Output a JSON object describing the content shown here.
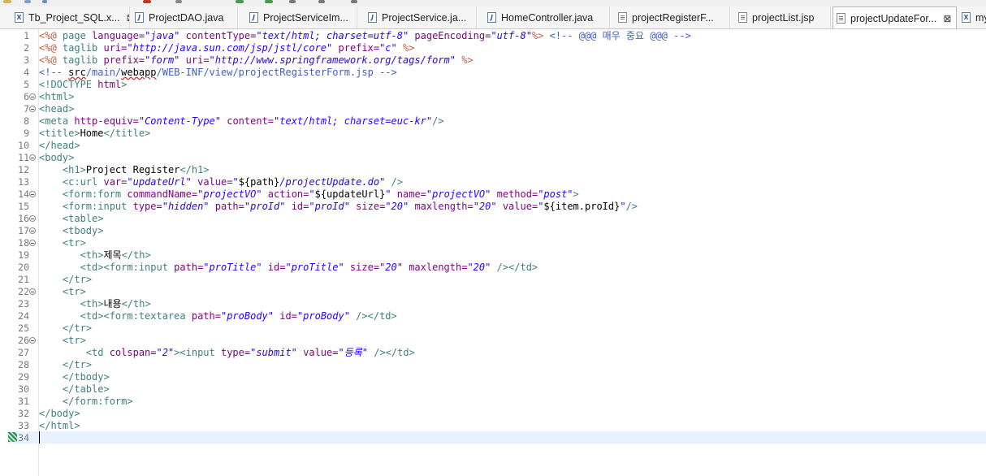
{
  "tabs": [
    {
      "label": "Tb_Project_SQL.x...",
      "icon": "xml-file-icon",
      "close": "⊠",
      "active": false
    },
    {
      "label": "ProjectDAO.java",
      "icon": "java-file-icon",
      "active": false
    },
    {
      "label": "ProjectServiceIm...",
      "icon": "java-file-icon",
      "active": false
    },
    {
      "label": "ProjectService.ja...",
      "icon": "java-file-icon",
      "active": false
    },
    {
      "label": "HomeController.java",
      "icon": "java-file-icon",
      "active": false
    },
    {
      "label": "projectRegisterF...",
      "icon": "jsp-file-icon",
      "active": false
    },
    {
      "label": "projectList.jsp",
      "icon": "jsp-file-icon",
      "active": false
    },
    {
      "label": "projectUpdateFor...",
      "icon": "jsp-file-icon",
      "close": "⊠",
      "active": true
    },
    {
      "label": "my",
      "icon": "xml-file-icon",
      "active": false
    }
  ],
  "icon_glyphs": {
    "xml": "X",
    "java": "J"
  },
  "line_numbers": [
    "1",
    "2",
    "3",
    "4",
    "5",
    "6",
    "7",
    "8",
    "9",
    "10",
    "11",
    "12",
    "13",
    "14",
    "15",
    "16",
    "17",
    "18",
    "19",
    "20",
    "21",
    "22",
    "23",
    "24",
    "25",
    "26",
    "27",
    "28",
    "29",
    "30",
    "31",
    "32",
    "33",
    "34"
  ],
  "code_lines": [
    {
      "num": "1",
      "fold": false,
      "segments": [
        [
          "jsp",
          "<%@ "
        ],
        [
          "k",
          "page "
        ],
        [
          "a",
          "language="
        ],
        [
          "s",
          "\"java\""
        ],
        [
          "a",
          " contentType="
        ],
        [
          "s",
          "\"text/html; charset=utf-8\""
        ],
        [
          "a",
          " pageEncoding="
        ],
        [
          "s",
          "\"utf-8\""
        ],
        [
          "jsp",
          "%>"
        ],
        [
          "cm",
          " <!-- @@@ 매우 중요 @@@ -->"
        ]
      ]
    },
    {
      "num": "2",
      "fold": false,
      "segments": [
        [
          "jsp",
          "<%@ "
        ],
        [
          "k",
          "taglib "
        ],
        [
          "a",
          "uri="
        ],
        [
          "s",
          "\"http://java.sun.com/jsp/jstl/core\""
        ],
        [
          "a",
          " prefix="
        ],
        [
          "s",
          "\"c\""
        ],
        [
          "jsp",
          " %>"
        ]
      ]
    },
    {
      "num": "3",
      "fold": false,
      "segments": [
        [
          "jsp",
          "<%@ "
        ],
        [
          "k",
          "taglib "
        ],
        [
          "a",
          "prefix="
        ],
        [
          "s",
          "\"form\""
        ],
        [
          "a",
          " uri="
        ],
        [
          "s",
          "\"http://www.springframework.org/tags/form\""
        ],
        [
          "jsp",
          " %>"
        ]
      ]
    },
    {
      "num": "4",
      "fold": false,
      "segments": [
        [
          "cm",
          "<!-- "
        ],
        [
          "ws",
          "src"
        ],
        [
          "cm",
          "/main/"
        ],
        [
          "ws",
          "webapp"
        ],
        [
          "cm",
          "/WEB-INF/view/projectRegisterForm.jsp -->"
        ]
      ]
    },
    {
      "num": "5",
      "fold": false,
      "segments": [
        [
          "k",
          "<!DOCTYPE "
        ],
        [
          "a",
          "html"
        ],
        [
          "k",
          ">"
        ]
      ]
    },
    {
      "num": "6",
      "fold": true,
      "segments": [
        [
          "k",
          "<html>"
        ]
      ]
    },
    {
      "num": "7",
      "fold": true,
      "segments": [
        [
          "k",
          "<head>"
        ]
      ]
    },
    {
      "num": "8",
      "fold": false,
      "segments": [
        [
          "k",
          "<meta "
        ],
        [
          "a",
          "http-equiv="
        ],
        [
          "s",
          "\"Content-Type\""
        ],
        [
          "a",
          " content="
        ],
        [
          "s",
          "\"text/html; charset=euc-kr\""
        ],
        [
          "k",
          "/>"
        ]
      ]
    },
    {
      "num": "9",
      "fold": false,
      "segments": [
        [
          "k",
          "<title>"
        ],
        [
          "t",
          "Home"
        ],
        [
          "k",
          "</title>"
        ]
      ]
    },
    {
      "num": "10",
      "fold": false,
      "segments": [
        [
          "k",
          "</head>"
        ]
      ]
    },
    {
      "num": "11",
      "fold": true,
      "segments": [
        [
          "k",
          "<body>"
        ]
      ]
    },
    {
      "num": "12",
      "fold": false,
      "segments": [
        [
          "t",
          "    "
        ],
        [
          "k",
          "<h1>"
        ],
        [
          "t",
          "Project Register"
        ],
        [
          "k",
          "</h1>"
        ]
      ]
    },
    {
      "num": "13",
      "fold": false,
      "segments": [
        [
          "t",
          "    "
        ],
        [
          "k",
          "<c:url "
        ],
        [
          "a",
          "var="
        ],
        [
          "s",
          "\"updateUrl\""
        ],
        [
          "a",
          " value="
        ],
        [
          "s",
          "\""
        ],
        [
          "t",
          "${path}"
        ],
        [
          "s",
          "/projectUpdate.do\""
        ],
        [
          "k",
          " />"
        ]
      ]
    },
    {
      "num": "14",
      "fold": true,
      "segments": [
        [
          "t",
          "    "
        ],
        [
          "k",
          "<form:form "
        ],
        [
          "a",
          "commandName="
        ],
        [
          "s",
          "\"projectVO\""
        ],
        [
          "a",
          " action="
        ],
        [
          "s",
          "\""
        ],
        [
          "t",
          "${updateUrl}"
        ],
        [
          "s",
          "\""
        ],
        [
          "a",
          " name="
        ],
        [
          "s",
          "\"projectVO\""
        ],
        [
          "a",
          " method="
        ],
        [
          "s",
          "\"post\""
        ],
        [
          "k",
          ">"
        ]
      ]
    },
    {
      "num": "15",
      "fold": false,
      "segments": [
        [
          "t",
          "    "
        ],
        [
          "k",
          "<form:input "
        ],
        [
          "a",
          "type="
        ],
        [
          "s",
          "\"hidden\""
        ],
        [
          "a",
          " path="
        ],
        [
          "s",
          "\"proId\""
        ],
        [
          "a",
          " id="
        ],
        [
          "s",
          "\"proId\""
        ],
        [
          "a",
          " size="
        ],
        [
          "s",
          "\"20\""
        ],
        [
          "a",
          " maxlength="
        ],
        [
          "s",
          "\"20\""
        ],
        [
          "a",
          " value="
        ],
        [
          "s",
          "\""
        ],
        [
          "t",
          "${item.proId}"
        ],
        [
          "s",
          "\""
        ],
        [
          "k",
          "/>"
        ]
      ]
    },
    {
      "num": "16",
      "fold": true,
      "segments": [
        [
          "t",
          "    "
        ],
        [
          "k",
          "<table>"
        ]
      ]
    },
    {
      "num": "17",
      "fold": true,
      "segments": [
        [
          "t",
          "    "
        ],
        [
          "k",
          "<tbody>"
        ]
      ]
    },
    {
      "num": "18",
      "fold": true,
      "segments": [
        [
          "t",
          "    "
        ],
        [
          "k",
          "<tr>"
        ]
      ]
    },
    {
      "num": "19",
      "fold": false,
      "segments": [
        [
          "t",
          "       "
        ],
        [
          "k",
          "<th>"
        ],
        [
          "t",
          "제목"
        ],
        [
          "k",
          "</th>"
        ]
      ]
    },
    {
      "num": "20",
      "fold": false,
      "segments": [
        [
          "t",
          "       "
        ],
        [
          "k",
          "<td><form:input "
        ],
        [
          "a",
          "path="
        ],
        [
          "s",
          "\"proTitle\""
        ],
        [
          "a",
          " id="
        ],
        [
          "s",
          "\"proTitle\""
        ],
        [
          "a",
          " size="
        ],
        [
          "s",
          "\"20\""
        ],
        [
          "a",
          " maxlength="
        ],
        [
          "s",
          "\"20\""
        ],
        [
          "k",
          " /></td>"
        ]
      ]
    },
    {
      "num": "21",
      "fold": false,
      "segments": [
        [
          "t",
          "    "
        ],
        [
          "k",
          "</tr>"
        ]
      ]
    },
    {
      "num": "22",
      "fold": true,
      "segments": [
        [
          "t",
          "    "
        ],
        [
          "k",
          "<tr>"
        ]
      ]
    },
    {
      "num": "23",
      "fold": false,
      "segments": [
        [
          "t",
          "       "
        ],
        [
          "k",
          "<th>"
        ],
        [
          "t",
          "내용"
        ],
        [
          "k",
          "</th>"
        ]
      ]
    },
    {
      "num": "24",
      "fold": false,
      "segments": [
        [
          "t",
          "       "
        ],
        [
          "k",
          "<td><form:textarea "
        ],
        [
          "a",
          "path="
        ],
        [
          "s",
          "\"proBody\""
        ],
        [
          "a",
          " id="
        ],
        [
          "s",
          "\"proBody\""
        ],
        [
          "k",
          " /></td>"
        ]
      ]
    },
    {
      "num": "25",
      "fold": false,
      "segments": [
        [
          "t",
          "    "
        ],
        [
          "k",
          "</tr>"
        ]
      ]
    },
    {
      "num": "26",
      "fold": true,
      "segments": [
        [
          "t",
          "    "
        ],
        [
          "k",
          "<tr>"
        ]
      ]
    },
    {
      "num": "27",
      "fold": false,
      "segments": [
        [
          "t",
          "        "
        ],
        [
          "k",
          "<td "
        ],
        [
          "a",
          "colspan="
        ],
        [
          "s",
          "\"2\""
        ],
        [
          "k",
          "><input "
        ],
        [
          "a",
          "type="
        ],
        [
          "s",
          "\"submit\""
        ],
        [
          "a",
          " value="
        ],
        [
          "s",
          "\"등록\""
        ],
        [
          "k",
          " /></td>"
        ]
      ]
    },
    {
      "num": "28",
      "fold": false,
      "segments": [
        [
          "t",
          "    "
        ],
        [
          "k",
          "</tr>"
        ]
      ]
    },
    {
      "num": "29",
      "fold": false,
      "segments": [
        [
          "t",
          "    "
        ],
        [
          "k",
          "</tbody>"
        ]
      ]
    },
    {
      "num": "30",
      "fold": false,
      "segments": [
        [
          "t",
          "    "
        ],
        [
          "k",
          "</table>"
        ]
      ]
    },
    {
      "num": "31",
      "fold": false,
      "segments": [
        [
          "t",
          "    "
        ],
        [
          "k",
          "</form:form>"
        ]
      ]
    },
    {
      "num": "32",
      "fold": false,
      "segments": [
        [
          "k",
          "</body>"
        ]
      ]
    },
    {
      "num": "33",
      "fold": false,
      "segments": [
        [
          "k",
          "</html>"
        ]
      ]
    },
    {
      "num": "34",
      "fold": false,
      "segments": []
    }
  ],
  "colors": {
    "tag": "#3f7f7f",
    "attribute": "#7f007f",
    "string": "#2a00ff",
    "jsp_directive": "#bf5f3f",
    "comment": "#3f5fbf",
    "current_line": "#e8f2fe"
  }
}
